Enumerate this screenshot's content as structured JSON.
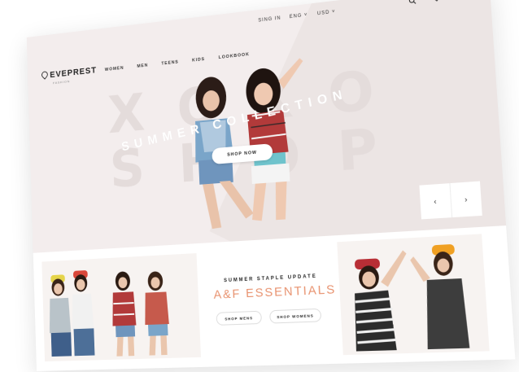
{
  "utility": {
    "sign_in": "SING IN",
    "language": "ENG",
    "currency": "USD"
  },
  "icons": {
    "search": "search-icon",
    "wishlist": "heart-icon",
    "cart": "cart-icon"
  },
  "logo": {
    "name": "EVEPREST",
    "tagline": "FASHION"
  },
  "nav": {
    "items": [
      "WOMEN",
      "MEN",
      "TEENS",
      "KIDS",
      "LOOKBOOK"
    ]
  },
  "hero": {
    "big_letters_row1": "XOXO",
    "big_letters_row2": "SHOP",
    "collection_text": "SUMMER COLLECTION",
    "button_label": "SHOP NOW",
    "prev_arrow": "‹",
    "next_arrow": "›"
  },
  "promo": {
    "kicker": "SUMMER STAPLE UPDATE",
    "title": "A&F ESSENTIALS",
    "shop_mens": "SHOP MENS",
    "shop_womens": "SHOP WOMENS"
  },
  "colors": {
    "accent": "#e8926f",
    "hero_bg": "#f3eded",
    "hero_diagonal": "#ece5e4"
  }
}
